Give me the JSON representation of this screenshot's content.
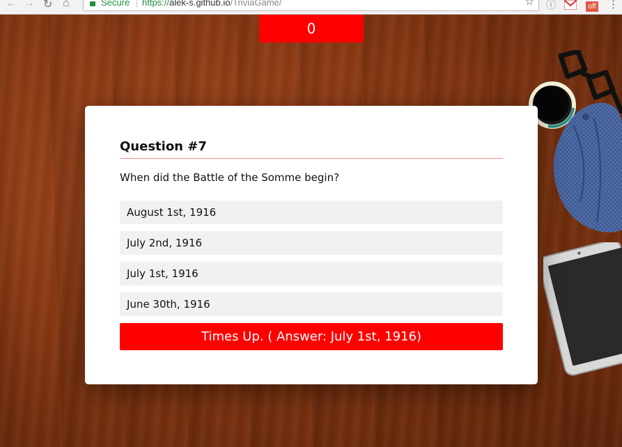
{
  "browser": {
    "secure_label": "Secure",
    "url_scheme": "https://",
    "url_host": "alek-s.github.io",
    "url_path": "/TriviaGame/",
    "extension_badge": "off"
  },
  "timer": {
    "value": "0"
  },
  "question": {
    "title": "Question #7",
    "text": "When did the Battle of the Somme begin?",
    "answers": [
      "August 1st, 1916",
      "July 2nd, 1916",
      "July 1st, 1916",
      "June 30th, 1916"
    ],
    "result": "Times Up. ( Answer: July 1st, 1916)"
  },
  "colors": {
    "accent_red": "#ff0000",
    "card_bg": "#ffffff",
    "answer_bg": "#f1f1f1",
    "rule": "#f08a8a",
    "secure_green": "#1e8e3e"
  },
  "icons": {
    "back": "arrow-left-icon",
    "forward": "arrow-right-icon",
    "reload": "reload-icon",
    "home": "home-icon",
    "lock": "lock-icon",
    "bookmark": "star-icon",
    "info": "info-icon",
    "gmail": "gmail-icon",
    "extension": "extension-icon",
    "menu": "kebab-menu-icon"
  }
}
